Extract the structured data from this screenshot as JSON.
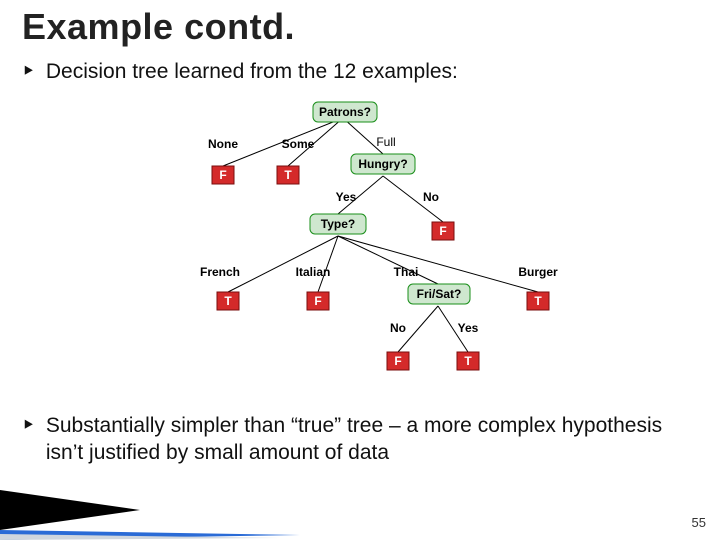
{
  "title": "Example contd.",
  "bullet1": "Decision tree learned from the 12 examples:",
  "bullet2": "Substantially simpler than “true” tree – a more complex hypothesis isn’t justified by small amount of data",
  "page_number": "55",
  "colors": {
    "decision_fill": "#cfe7cf",
    "decision_border": "#1a8f1a",
    "leaf_true": "#d42a2a",
    "leaf_false": "#d42a2a",
    "leaf_text": "#ffffff",
    "accent": "#2a6bd6"
  },
  "tree": {
    "root": {
      "label": "Patrons?",
      "edges": [
        "None",
        "Some",
        "Full"
      ]
    },
    "hungry": {
      "label": "Hungry?",
      "edges": [
        "Yes",
        "No"
      ]
    },
    "type": {
      "label": "Type?",
      "edges": [
        "French",
        "Italian",
        "Thai",
        "Burger"
      ]
    },
    "frisat": {
      "label": "Fri/Sat?",
      "edges": [
        "No",
        "Yes"
      ]
    },
    "leaves": {
      "T": "T",
      "F": "F"
    }
  },
  "chart_data": {
    "type": "table",
    "title": "Decision tree learned from the 12 examples",
    "note": "Tree structure. decision nodes in green rounded boxes, leaves T/F in red boxes.",
    "nodes": [
      {
        "id": "patrons",
        "kind": "decision",
        "label": "Patrons?",
        "children": [
          {
            "edge": "None",
            "to": "leaf_F1"
          },
          {
            "edge": "Some",
            "to": "leaf_T1"
          },
          {
            "edge": "Full",
            "to": "hungry"
          }
        ]
      },
      {
        "id": "leaf_F1",
        "kind": "leaf",
        "value": "F"
      },
      {
        "id": "leaf_T1",
        "kind": "leaf",
        "value": "T"
      },
      {
        "id": "hungry",
        "kind": "decision",
        "label": "Hungry?",
        "children": [
          {
            "edge": "Yes",
            "to": "type"
          },
          {
            "edge": "No",
            "to": "leaf_F2"
          }
        ]
      },
      {
        "id": "leaf_F2",
        "kind": "leaf",
        "value": "F"
      },
      {
        "id": "type",
        "kind": "decision",
        "label": "Type?",
        "children": [
          {
            "edge": "French",
            "to": "leaf_T2"
          },
          {
            "edge": "Italian",
            "to": "leaf_F3"
          },
          {
            "edge": "Thai",
            "to": "frisat"
          },
          {
            "edge": "Burger",
            "to": "leaf_T3"
          }
        ]
      },
      {
        "id": "leaf_T2",
        "kind": "leaf",
        "value": "T"
      },
      {
        "id": "leaf_F3",
        "kind": "leaf",
        "value": "F"
      },
      {
        "id": "leaf_T3",
        "kind": "leaf",
        "value": "T"
      },
      {
        "id": "frisat",
        "kind": "decision",
        "label": "Fri/Sat?",
        "children": [
          {
            "edge": "No",
            "to": "leaf_F4"
          },
          {
            "edge": "Yes",
            "to": "leaf_T4"
          }
        ]
      },
      {
        "id": "leaf_F4",
        "kind": "leaf",
        "value": "F"
      },
      {
        "id": "leaf_T4",
        "kind": "leaf",
        "value": "T"
      }
    ]
  }
}
